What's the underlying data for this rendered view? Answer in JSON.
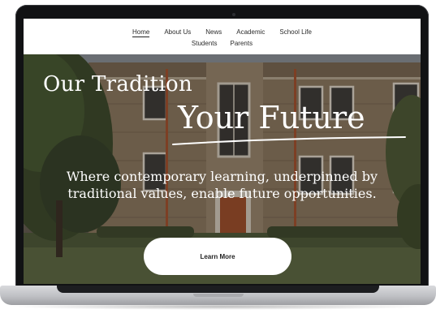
{
  "nav": {
    "row1": [
      {
        "label": "Home",
        "active": true
      },
      {
        "label": "About Us"
      },
      {
        "label": "News"
      },
      {
        "label": "Academic"
      },
      {
        "label": "School Life"
      }
    ],
    "row2": [
      {
        "label": "Students"
      },
      {
        "label": "Parents"
      }
    ]
  },
  "hero": {
    "title_line1": "Our Tradition",
    "title_line2": "Your Future",
    "tagline_line1": "Where contemporary learning, underpinned by",
    "tagline_line2": "traditional values, enable future opportunities.",
    "cta_label": "Learn More"
  },
  "colors": {
    "bezel": "#111214",
    "nav_background": "#ffffff",
    "hero_text": "#ffffff",
    "cta_background": "#ffffff",
    "laptop_body": "#c4c5c9"
  }
}
